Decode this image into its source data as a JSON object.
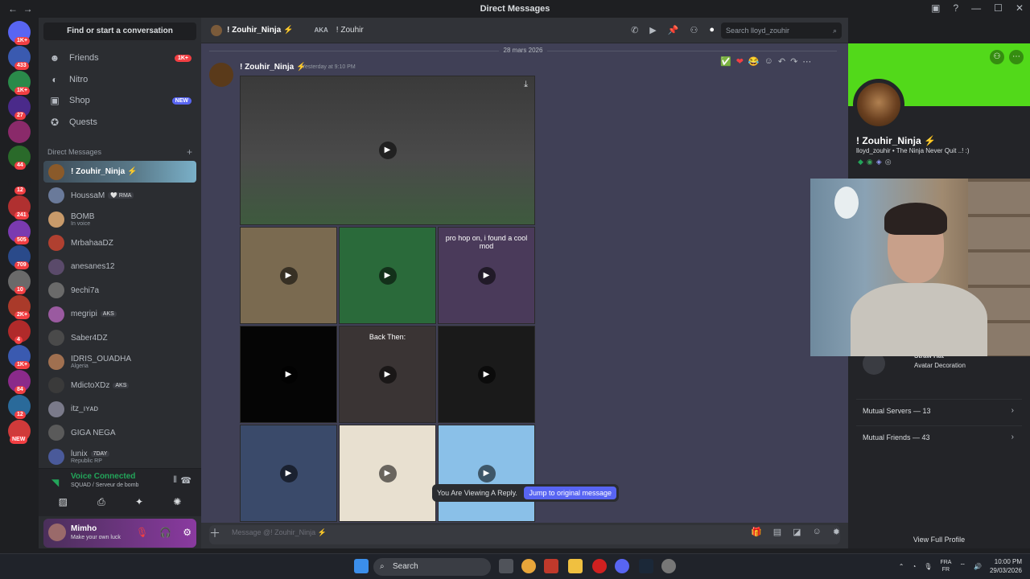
{
  "window": {
    "title": "Direct Messages"
  },
  "servers": {
    "badges": [
      "1K+",
      "433",
      "1K+",
      "27",
      "",
      "44",
      "12",
      "241",
      "505",
      "709",
      "10",
      "2K+",
      "4",
      "1K+",
      "84",
      "12",
      "NEW"
    ]
  },
  "sidebar": {
    "find_label": "Find or start a conversation",
    "nav": [
      {
        "label": "Friends",
        "icon": "friends-icon",
        "pill": "1K+",
        "pill_color": "#f23f43"
      },
      {
        "label": "Nitro",
        "icon": "nitro-icon",
        "pill": "",
        "pill_color": ""
      },
      {
        "label": "Shop",
        "icon": "shop-icon",
        "pill": "NEW",
        "pill_color": "#5865f2"
      },
      {
        "label": "Quests",
        "icon": "quests-icon",
        "pill": "",
        "pill_color": ""
      }
    ],
    "dm_header": "Direct Messages",
    "dms": [
      {
        "name": "! Zouhir_Ninja ⚡",
        "sub": "",
        "tag": "",
        "color": "#8a5a2a"
      },
      {
        "name": "HoussaM",
        "sub": "",
        "tag": "🤍 RMA",
        "color": "#6a7a9a"
      },
      {
        "name": "BOMB",
        "sub": "In voice",
        "tag": "",
        "color": "#c89a6a"
      },
      {
        "name": "MrbahaaDZ",
        "sub": "",
        "tag": "",
        "color": "#b04030"
      },
      {
        "name": "anesanes12",
        "sub": "",
        "tag": "",
        "color": "#5a4a6a"
      },
      {
        "name": "9echi7a",
        "sub": "",
        "tag": "",
        "color": "#6a6a6a"
      },
      {
        "name": "megripi",
        "sub": "",
        "tag": "AKS",
        "color": "#9a5aa0"
      },
      {
        "name": "Saber4DZ",
        "sub": "",
        "tag": "",
        "color": "#4a4a4a"
      },
      {
        "name": "IDRIS_OUADHA",
        "sub": "Algeria",
        "tag": "",
        "color": "#a07050"
      },
      {
        "name": "MdictoXDz",
        "sub": "",
        "tag": "AKS",
        "color": "#3a3a3a"
      },
      {
        "name": "itz_ıʏᴀᴅ",
        "sub": "",
        "tag": "",
        "color": "#7a7a8a"
      },
      {
        "name": "GIGA NEGA",
        "sub": "",
        "tag": "",
        "color": "#5a5a5a"
      },
      {
        "name": "lunix",
        "sub": "Republic RP",
        "tag": "7DAY",
        "color": "#4a5a9a"
      }
    ],
    "voice": {
      "status": "Voice Connected",
      "channel": "SQUAD / Serveur de bomb"
    },
    "user": {
      "name": "Mimho",
      "status": "Make your own luck"
    }
  },
  "chat_header": {
    "name": "! Zouhir_Ninja ⚡",
    "aka_label": "AKA",
    "aka_value": "! Zouhir",
    "search_placeholder": "Search lloyd_zouhir"
  },
  "chat": {
    "date": "28 mars 2026",
    "author": "! Zouhir_Ninja ⚡",
    "time": "Yesterday at 9:10 PM",
    "media_captions": [
      "",
      "",
      "pro hop on, i found a cool mod",
      "",
      "Back Then:",
      "",
      "",
      "",
      ""
    ],
    "reply_notice": "You Are Viewing A Reply.",
    "jump_label": "Jump to original message",
    "composer_placeholder": "Message @! Zouhir_Ninja ⚡"
  },
  "profile": {
    "display_name": "! Zouhir_Ninja ⚡",
    "username_line": "lloyd_zouhir • The Ninja Never Quit ..! :)",
    "deco_name": "Straw Hat",
    "deco_type": "Avatar Decoration",
    "mutual_servers": "Mutual Servers — 13",
    "mutual_friends": "Mutual Friends — 43",
    "view_full": "View Full Profile",
    "banner_color": "#52d91a"
  },
  "taskbar": {
    "search_label": "Search",
    "lang_top": "FRA",
    "lang_bottom": "FR",
    "time": "10:00 PM",
    "date": "29/03/2026"
  }
}
